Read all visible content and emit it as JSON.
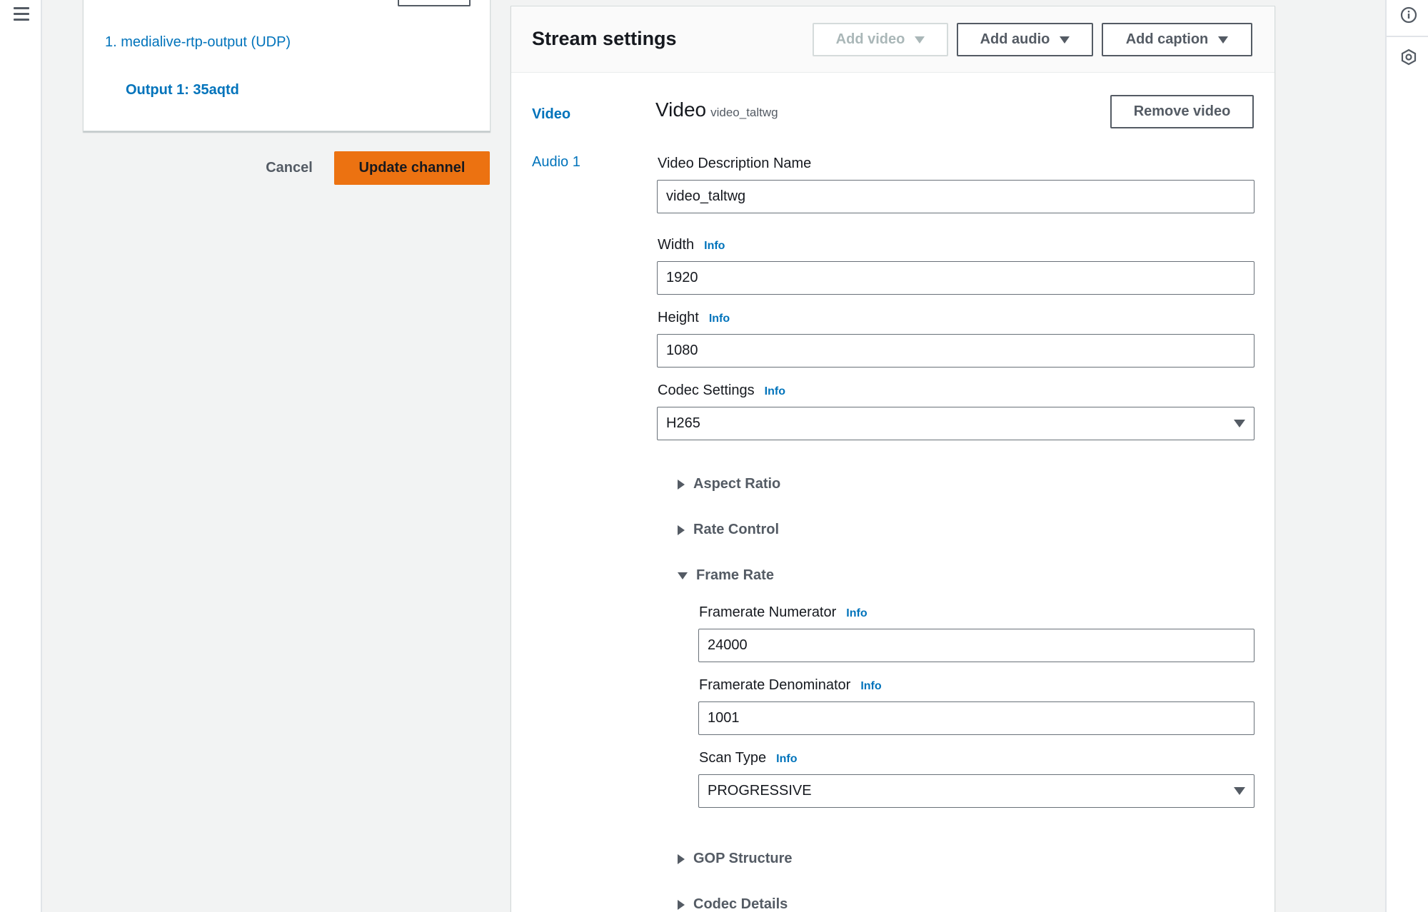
{
  "nav": {
    "menu_icon": "hamburger-menu-icon"
  },
  "rail": {
    "info_icon": "info-circle-icon",
    "settings_icon": "hexagon-settings-icon"
  },
  "outputs_panel": {
    "pipeline_label": "1. medialive-rtp-output (UDP)",
    "output_label": "Output 1: 35aqtd"
  },
  "actions": {
    "cancel_label": "Cancel",
    "update_label": "Update channel"
  },
  "stream_settings": {
    "title": "Stream settings",
    "add_video_label": "Add video",
    "add_audio_label": "Add audio",
    "add_caption_label": "Add caption",
    "tabs": [
      {
        "label": "Video",
        "active": true
      },
      {
        "label": "Audio 1",
        "active": false
      }
    ],
    "video": {
      "heading": "Video",
      "subheading": "video_taltwg",
      "remove_label": "Remove video",
      "description_name_label": "Video Description Name",
      "description_name_value": "video_taltwg",
      "width_label": "Width",
      "width_value": "1920",
      "height_label": "Height",
      "height_value": "1080",
      "codec_label": "Codec Settings",
      "codec_value": "H265",
      "info_label": "Info",
      "aspect_ratio_label": "Aspect Ratio",
      "rate_control_label": "Rate Control",
      "frame_rate_label": "Frame Rate",
      "framerate_numerator_label": "Framerate Numerator",
      "framerate_numerator_value": "24000",
      "framerate_denominator_label": "Framerate Denominator",
      "framerate_denominator_value": "1001",
      "scan_type_label": "Scan Type",
      "scan_type_value": "PROGRESSIVE",
      "gop_label": "GOP Structure",
      "codec_details_label": "Codec Details"
    }
  },
  "colors": {
    "primary": "#ec7211",
    "link": "#0073bb",
    "background": "#f2f3f3"
  }
}
